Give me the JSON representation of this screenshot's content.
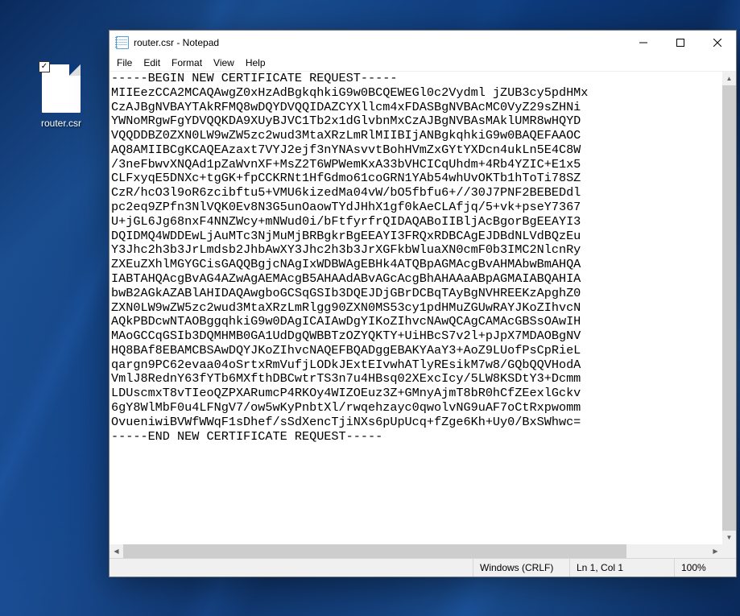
{
  "desktop": {
    "file_label": "router.csr",
    "checkbox_glyph": "✓"
  },
  "window": {
    "title": "router.csr - Notepad",
    "menus": {
      "file": "File",
      "edit": "Edit",
      "format": "Format",
      "view": "View",
      "help": "Help"
    },
    "text_content": "-----BEGIN NEW CERTIFICATE REQUEST-----\nMIIEezCCA2MCAQAwgZ0xHzAdBgkqhkiG9w0BCQEWEGl0c2Vydml jZUB3cy5pdHMx\nCzAJBgNVBAYTAkRFMQ8wDQYDVQQIDAZCYXllcm4xFDASBgNVBAcMC0VyZ29sZHNi\nYWNoMRgwFgYDVQQKDA9XUyBJVC1Tb2x1dGlvbnMxCzAJBgNVBAsMAklUMR8wHQYD\nVQQDDBZ0ZXN0LW9wZW5zc2wud3MtaXRzLmRlMIIBIjANBgkqhkiG9w0BAQEFAAOC\nAQ8AMIIBCgKCAQEAzaxt7VYJ2ejf3nYNAsvvtBohHVmZxGYtYXDcn4ukLn5E4C8W\n/3neFbwvXNQAd1pZaWvnXF+MsZ2T6WPWemKxA33bVHCICqUhdm+4Rb4YZIC+E1x5\nCLFxyqE5DNXc+tgGK+fpCCKRNt1HfGdmo61coGRN1YAb54whUvOKTb1hToTi78SZ\nCzR/hcO3l9oR6zcibftu5+VMU6kizedMa04vW/bO5fbfu6+//30J7PNF2BEBEDdl\npc2eq9ZPfn3NlVQK0Ev8N3G5unOaowTYdJHhX1gf0kAeCLAfjq/5+vk+pseY7367\nU+jGL6Jg68nxF4NNZWcy+mNWud0i/bFtfyrfrQIDAQABoIIBljAcBgorBgEEAYI3\nDQIDMQ4WDDEwLjAuMTc3NjMuMjBRBgkrBgEEAYI3FRQxRDBCAgEJDBdNLVdBQzEu\nY3Jhc2h3b3JrLmdsb2JhbAwXY3Jhc2h3b3JrXGFkbWluaXN0cmF0b3IMC2NlcnRy\nZXEuZXhlMGYGCisGAQQBgjcNAgIxWDBWAgEBHk4ATQBpAGMAcgBvAHMAbwBmAHQA\nIABTAHQAcgBvAG4AZwAgAEMAcgB5AHAAdABvAGcAcgBhAHAAaABpAGMAIABQAHIA\nbwB2AGkAZABlAHIDAQAwgboGCSqGSIb3DQEJDjGBrDCBqTAyBgNVHREEKzApghZ0\nZXN0LW9wZW5zc2wud3MtaXRzLmRlgg90ZXN0MS53cy1pdHMuZGUwRAYJKoZIhvcN\nAQkPBDcwNTAOBggqhkiG9w0DAgICAIAwDgYIKoZIhvcNAwQCAgCAMAcGBSsOAwIH\nMAoGCCqGSIb3DQMHMB0GA1UdDgQWBBTzOZYQKTY+UiHBcS7v2l+pJpX7MDAOBgNV\nHQ8BAf8EBAMCBSAwDQYJKoZIhvcNAQEFBQADggEBAKYAaY3+AoZ9LUofPsCpRieL\nqargn9PC62evaa04oSrtxRmVufjLODkJExtEIvwhATlyREsikM7w8/GQbQQVHodA\nVmlJ8RednY63fYTb6MXfthDBCwtrTS3n7u4HBsq02XExcIcy/5LW8KSDtY3+Dcmm\nLDUscmxT8vTIeoQZPXARumcP4RKOy4WIZOEuz3Z+GMnyAjmT8bR0hCfZEexlGckv\n6gY8WlMbF0u4LFNgV7/ow5wKyPnbtXl/rwqehzayc0qwolvNG9uAF7oCtRxpwomm\nOvueniwiBVWfWWqF1sDhef/sSdXencTjiNXs6pUpUcq+fZge6Kh+Uy0/BxSWhwc=\n-----END NEW CERTIFICATE REQUEST-----",
    "status": {
      "encoding": "Windows (CRLF)",
      "position": "Ln 1, Col 1",
      "zoom": "100%"
    }
  }
}
